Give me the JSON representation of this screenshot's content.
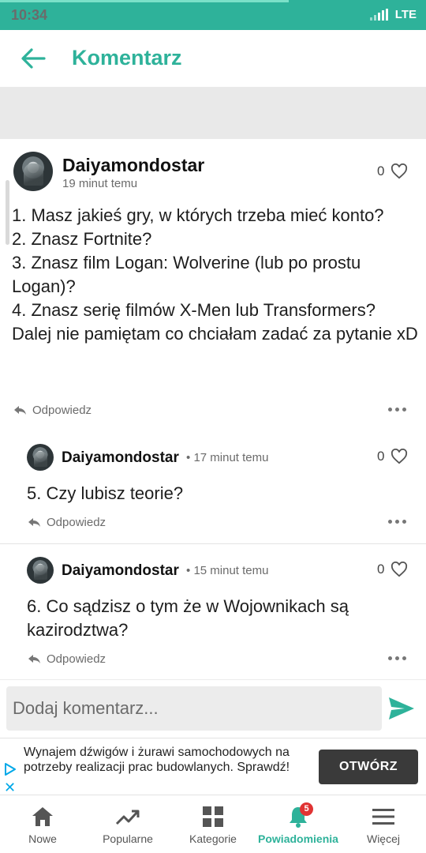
{
  "status_bar": {
    "time": "10:34",
    "network": "LTE"
  },
  "app_bar": {
    "title": "Komentarz"
  },
  "comments": [
    {
      "author": "Daiyamondostar",
      "time": "19 minut temu",
      "likes": "0",
      "body": "1. Masz jakieś gry, w których trzeba mieć konto?\n2. Znasz Fortnite?\n3. Znasz film Logan: Wolverine (lub po prostu Logan)?\n4. Znasz serię filmów X-Men lub Transformers?\nDalej nie pamiętam co chciałam zadać za pytanie xD",
      "reply_label": "Odpowiedz"
    },
    {
      "author": "Daiyamondostar",
      "time": "17 minut temu",
      "likes": "0",
      "body": "5. Czy lubisz teorie?",
      "reply_label": "Odpowiedz"
    },
    {
      "author": "Daiyamondostar",
      "time": "15 minut temu",
      "likes": "0",
      "body": "6. Co sądzisz o tym że w Wojownikach są kazirodztwa?",
      "reply_label": "Odpowiedz"
    }
  ],
  "time_separator": "•",
  "comment_input": {
    "placeholder": "Dodaj komentarz..."
  },
  "ad": {
    "text": "Wynajem dźwigów i żurawi samochodowych na potrzeby realizacji prac budowlanych. Sprawdź!",
    "cta": "OTWÓRZ",
    "close_glyph": "✕"
  },
  "bottom_nav": {
    "items": [
      {
        "label": "Nowe",
        "icon": "home-icon"
      },
      {
        "label": "Popularne",
        "icon": "trending-icon"
      },
      {
        "label": "Kategorie",
        "icon": "grid-icon"
      },
      {
        "label": "Powiadomienia",
        "icon": "bell-icon",
        "badge": "5",
        "active": true
      },
      {
        "label": "Więcej",
        "icon": "menu-icon"
      }
    ]
  },
  "colors": {
    "accent": "#2eb29a",
    "badge": "#e03333",
    "cta_bg": "#3a3a3a",
    "ad_icon": "#00a8e8"
  }
}
